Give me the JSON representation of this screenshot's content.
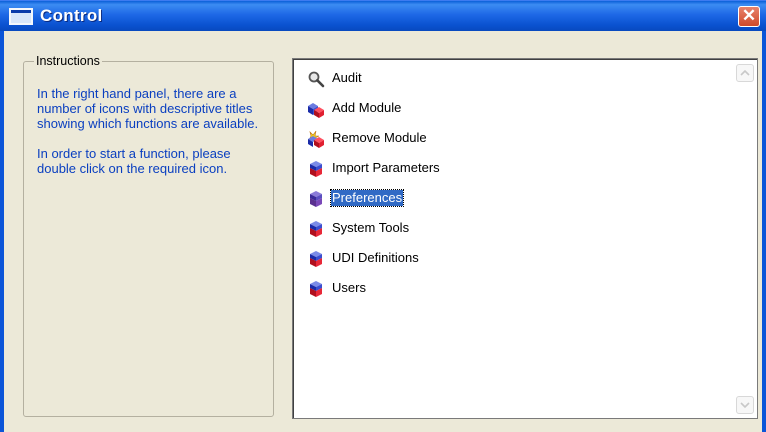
{
  "window": {
    "title": "Control",
    "close_glyph": "✕"
  },
  "instructions": {
    "legend": "Instructions",
    "paragraph1": "In the right hand panel, there are a number of icons with descriptive titles showing which functions are available.",
    "paragraph2": "In order to start a function, please double click on the required icon."
  },
  "functions": {
    "items": [
      {
        "label": "Audit",
        "icon": "magnifier-icon"
      },
      {
        "label": "Add Module",
        "icon": "add-module-icon"
      },
      {
        "label": "Remove Module",
        "icon": "remove-module-icon"
      },
      {
        "label": "Import Parameters",
        "icon": "cube-icon"
      },
      {
        "label": "Preferences",
        "icon": "cube-icon",
        "selected": true
      },
      {
        "label": "System Tools",
        "icon": "cube-icon"
      },
      {
        "label": "UDI Definitions",
        "icon": "cube-icon"
      },
      {
        "label": "Users",
        "icon": "cube-icon"
      }
    ]
  },
  "colors": {
    "titlebar": "#0A52D0",
    "instruction_text": "#0A3FC0",
    "selection": "#316AC5",
    "dialog_bg": "#ECE9D8"
  }
}
